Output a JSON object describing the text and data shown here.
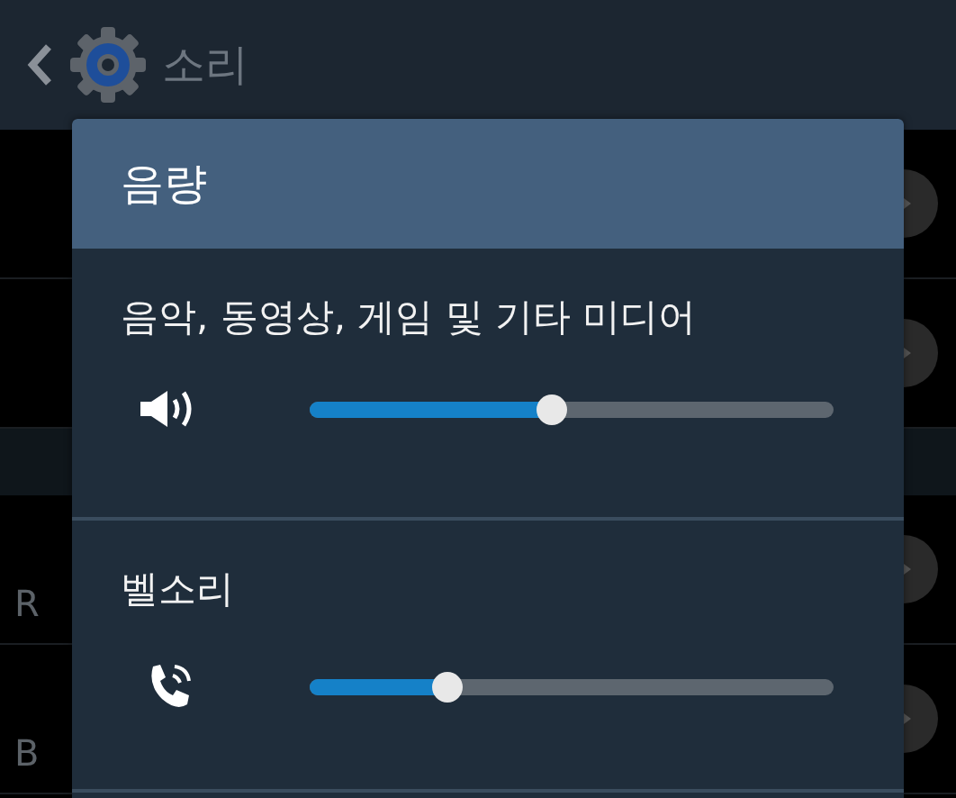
{
  "top_bar": {
    "title": "소리"
  },
  "background_list": [
    {
      "kind": "row"
    },
    {
      "kind": "row"
    },
    {
      "kind": "header"
    },
    {
      "kind": "row",
      "subtitle": "R"
    },
    {
      "kind": "row",
      "subtitle": "B"
    }
  ],
  "dialog": {
    "title": "음량",
    "channels": [
      {
        "name": "음악, 동영상, 게임 및 기타 미디어",
        "level": 0.46
      },
      {
        "name": "벨소리",
        "level": 0.26
      }
    ]
  }
}
